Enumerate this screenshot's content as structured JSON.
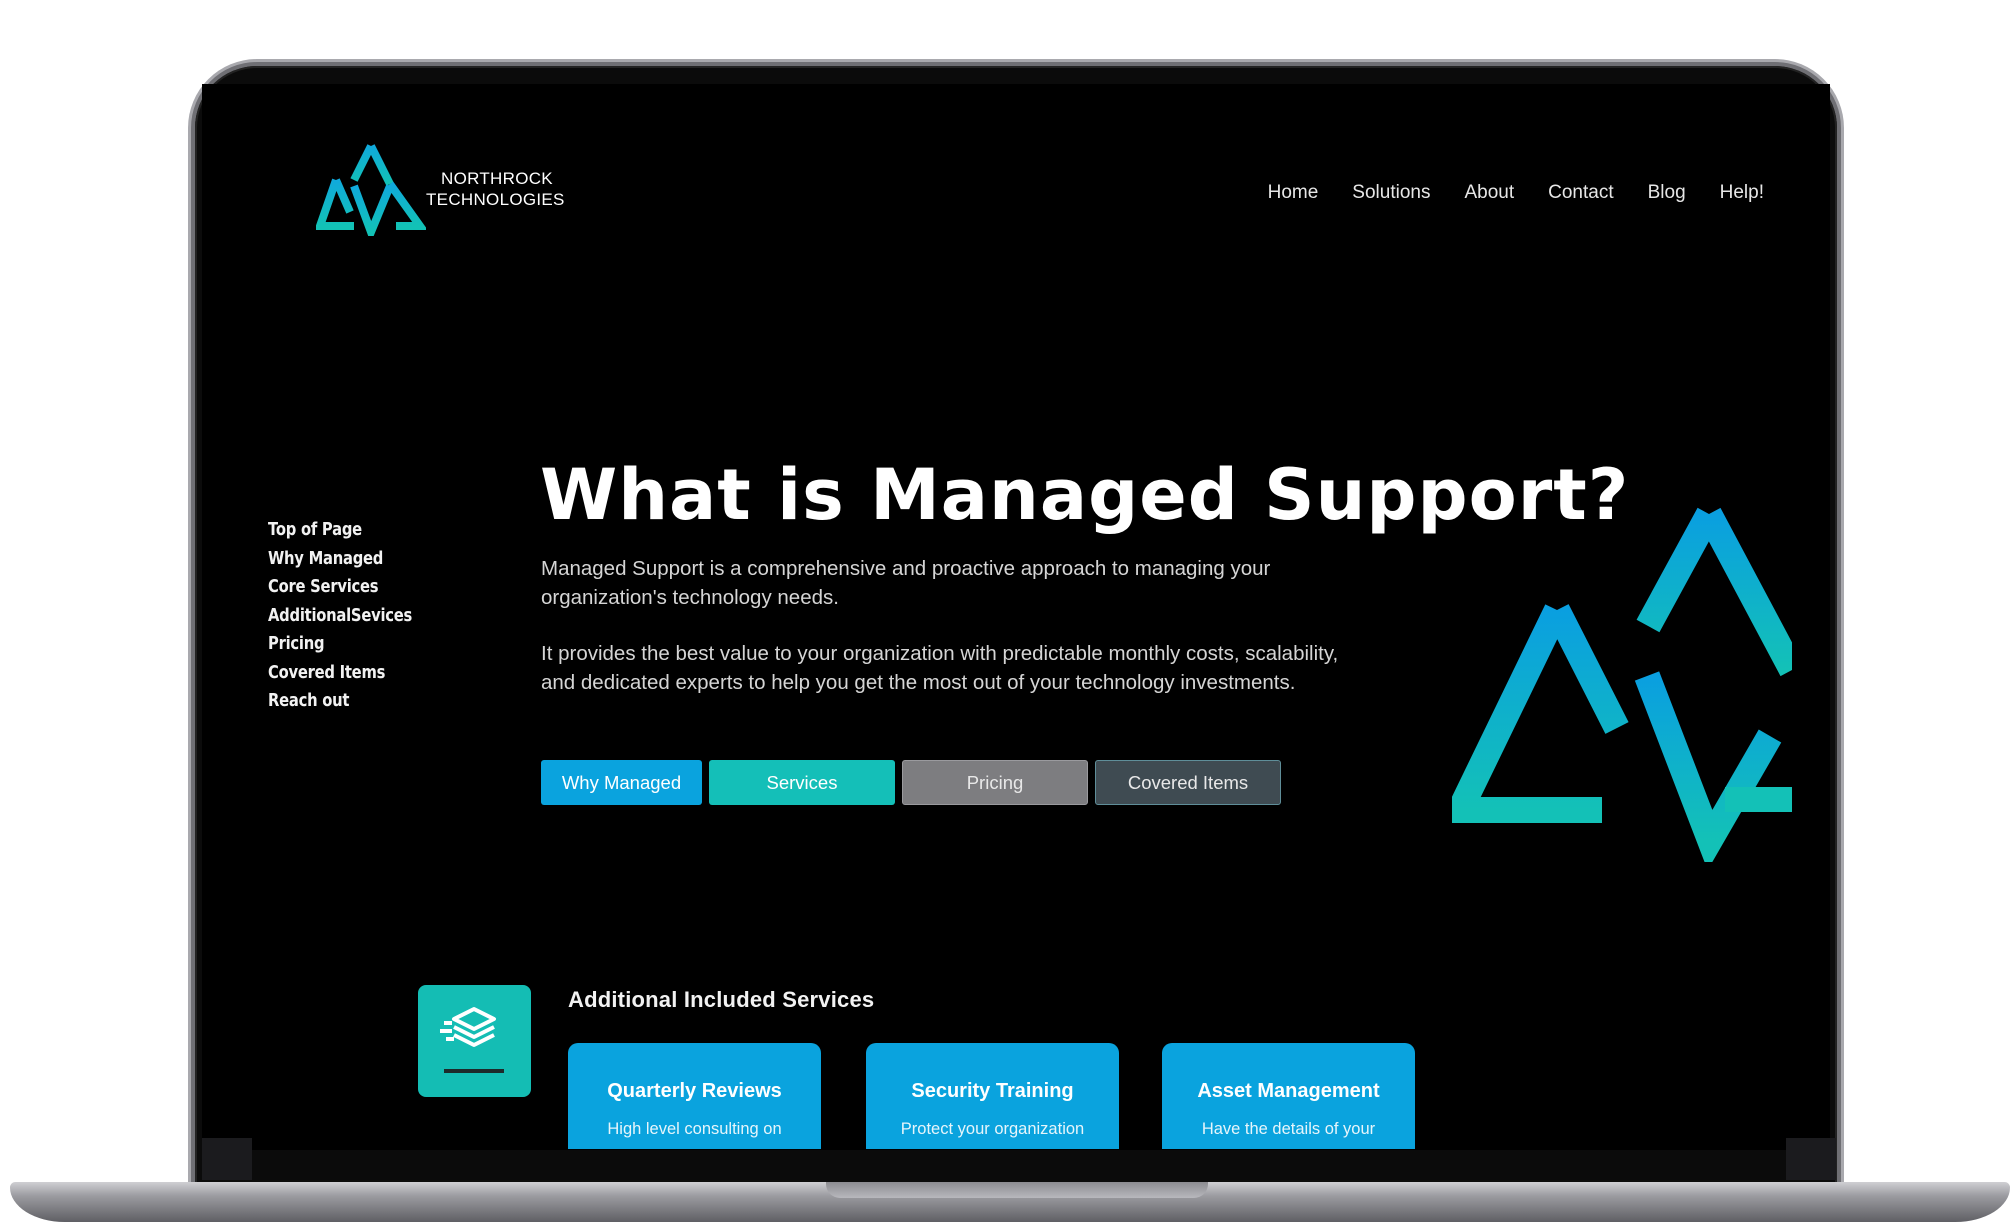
{
  "brand": {
    "line1": "NORTHROCK",
    "line2": "TECHNOLOGIES"
  },
  "nav": [
    "Home",
    "Solutions",
    "About",
    "Contact",
    "Blog",
    "Help!"
  ],
  "sidenav": [
    "Top of Page",
    "Why Managed",
    "Core Services",
    "AdditionalSevices",
    "Pricing",
    "Covered Items",
    "Reach out"
  ],
  "hero": {
    "title": "What is Managed Support?",
    "p1": "Managed Support is a comprehensive and proactive approach to managing your organization's technology needs.",
    "p2": "It provides the best value to your organization with predictable monthly costs, scalability, and dedicated experts to help you get the most out of your technology investments."
  },
  "buttons": {
    "why": "Why Managed",
    "services": "Services",
    "pricing": "Pricing",
    "covered": "Covered Items"
  },
  "services": {
    "heading": "Additional Included Services",
    "cards": [
      {
        "title": "Quarterly Reviews",
        "desc": "High level consulting on"
      },
      {
        "title": "Security Training",
        "desc": "Protect your organization"
      },
      {
        "title": "Asset Management",
        "desc": "Have the details of your"
      }
    ]
  },
  "colors": {
    "accent_blue": "#0aa3de",
    "accent_teal": "#14bfb8",
    "background": "#000000",
    "pricing_gray": "#7d7d80",
    "covered_slate": "#3f4b52"
  },
  "icons": {
    "logo": "northrock-mountain-logo-icon",
    "services": "layers-stack-icon"
  }
}
